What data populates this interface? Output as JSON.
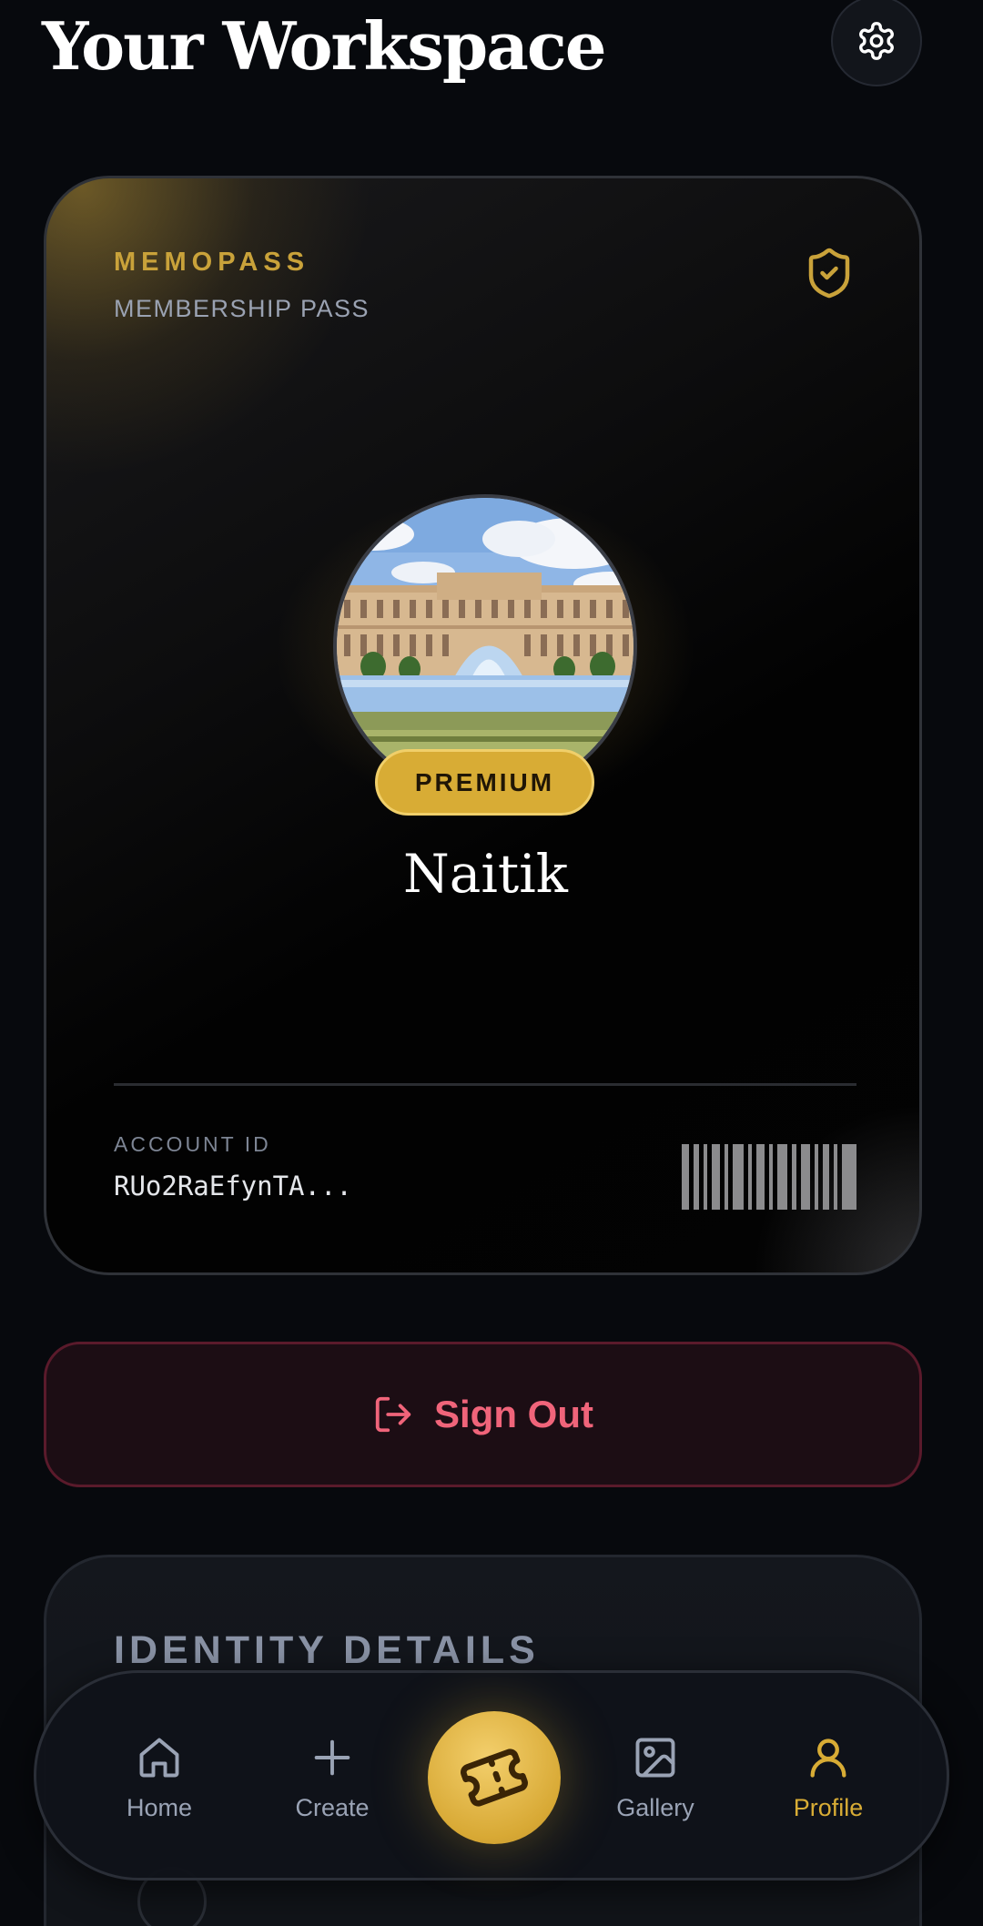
{
  "header": {
    "title": "Your Workspace",
    "settings_icon": "gear-icon"
  },
  "member_card": {
    "brand": "MEMOPASS",
    "subtitle": "MEMBERSHIP PASS",
    "verified_icon": "shield-check-icon",
    "badge": "PREMIUM",
    "name": "Naitik",
    "account_label": "ACCOUNT ID",
    "account_id": "RUo2RaEfynTA...",
    "accent_color": "#d8ac35"
  },
  "signout": {
    "label": "Sign Out",
    "icon": "logout-icon",
    "color": "#f0647a"
  },
  "identity": {
    "title": "IDENTITY DETAILS"
  },
  "nav": {
    "items": [
      {
        "label": "Home",
        "icon": "home-icon",
        "active": false
      },
      {
        "label": "Create",
        "icon": "plus-icon",
        "active": false
      },
      {
        "label": "",
        "icon": "ticket-icon",
        "active": false
      },
      {
        "label": "Gallery",
        "icon": "image-icon",
        "active": false
      },
      {
        "label": "Profile",
        "icon": "user-icon",
        "active": true
      }
    ],
    "active_color": "#d8ac35"
  }
}
